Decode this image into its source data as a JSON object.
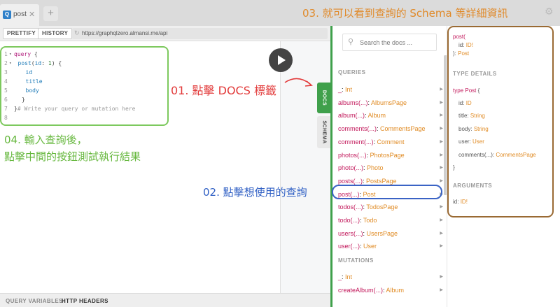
{
  "tab": {
    "logo": "Q",
    "title": "post",
    "close": "✕",
    "add": "+"
  },
  "toolbar": {
    "prettify": "PRETTIFY",
    "history": "HISTORY",
    "url": "https://graphqlzero.almansi.me/api"
  },
  "editor": {
    "lines": [
      {
        "num": "1",
        "fold": "▾",
        "parts": [
          [
            "kw",
            "query"
          ],
          [
            "",
            "{"
          ]
        ]
      },
      {
        "num": "2",
        "fold": "▾",
        "parts": [
          [
            "fn",
            "post"
          ],
          [
            "",
            "("
          ],
          [
            "attr",
            "id"
          ],
          [
            "",
            ": "
          ],
          [
            "num",
            "1"
          ],
          [
            "",
            ") {"
          ]
        ]
      },
      {
        "num": "3",
        "fold": "",
        "parts": [
          [
            "field",
            "id"
          ]
        ]
      },
      {
        "num": "4",
        "fold": "",
        "parts": [
          [
            "field",
            "title"
          ]
        ]
      },
      {
        "num": "5",
        "fold": "",
        "parts": [
          [
            "field",
            "body"
          ]
        ]
      },
      {
        "num": "6",
        "fold": "",
        "parts": [
          [
            "",
            "}"
          ]
        ]
      },
      {
        "num": "7",
        "fold": "",
        "parts": [
          [
            "",
            "}"
          ],
          [
            "cmt",
            "# Write your query or mutation here"
          ]
        ]
      },
      {
        "num": "8",
        "fold": "",
        "parts": []
      }
    ]
  },
  "side_tabs": {
    "docs": "DOCS",
    "schema": "SCHEMA"
  },
  "bottom": {
    "query_variables": "QUERY VARIABLES",
    "http_headers": "HTTP HEADERS"
  },
  "annotations": {
    "note_01": "01. 點擊 DOCS 標籤",
    "note_02": "02. 點擊想使用的查詢",
    "note_03": "03. 就可以看到查詢的 Schema 等詳細資訊",
    "note_04_line1": "04. 輸入查詢後，",
    "note_04_line2": "點擊中間的按鈕測試執行結果"
  },
  "docs": {
    "search_placeholder": "Search the docs ...",
    "queries_title": "QUERIES",
    "queries": [
      {
        "name": "_",
        "type": "Int"
      },
      {
        "name": "albums(...)",
        "type": "AlbumsPage"
      },
      {
        "name": "album(...)",
        "type": "Album"
      },
      {
        "name": "comments(...)",
        "type": "CommentsPage"
      },
      {
        "name": "comment(...)",
        "type": "Comment"
      },
      {
        "name": "photos(...)",
        "type": "PhotosPage"
      },
      {
        "name": "photo(...)",
        "type": "Photo"
      },
      {
        "name": "posts(...)",
        "type": "PostsPage"
      },
      {
        "name": "post(...)",
        "type": "Post"
      },
      {
        "name": "todos(...)",
        "type": "TodosPage"
      },
      {
        "name": "todo(...)",
        "type": "Todo"
      },
      {
        "name": "users(...)",
        "type": "UsersPage"
      },
      {
        "name": "user(...)",
        "type": "User"
      }
    ],
    "mutations_title": "MUTATIONS",
    "mutations": [
      {
        "name": "_",
        "type": "Int"
      },
      {
        "name": "createAlbum(...)",
        "type": "Album"
      }
    ]
  },
  "detail": {
    "sig_name": "post(",
    "sig_arg_name": "id:",
    "sig_arg_type": "ID!",
    "sig_close": "):",
    "sig_type": "Post",
    "type_details_title": "TYPE DETAILS",
    "type_kw": "type",
    "type_name": "Post",
    "type_open": "{",
    "type_close": "}",
    "fields": [
      {
        "name": "id:",
        "type": "ID"
      },
      {
        "name": "title:",
        "type": "String"
      },
      {
        "name": "body:",
        "type": "String"
      },
      {
        "name": "user:",
        "type": "User"
      },
      {
        "name": "comments(...):",
        "type": "CommentsPage"
      }
    ],
    "arguments_title": "ARGUMENTS",
    "arg_name": "id:",
    "arg_type": "ID!"
  }
}
